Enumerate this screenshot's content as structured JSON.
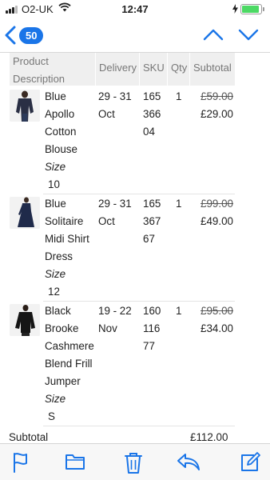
{
  "status_bar": {
    "carrier": "O2-UK",
    "time": "12:47",
    "battery_level": 0.92
  },
  "nav": {
    "unread_count": "50"
  },
  "table": {
    "headers": {
      "product_line1": "Product",
      "product_line2": "Description",
      "delivery": "Delivery",
      "sku": "SKU",
      "qty": "Qty",
      "subtotal": "Subtotal"
    },
    "rows": [
      {
        "desc": [
          "Blue",
          "Apollo",
          "Cotton",
          "Blouse"
        ],
        "size_label": "Size",
        "size_value": "10",
        "delivery": [
          "29 - 31",
          "Oct"
        ],
        "sku": [
          "165",
          "366",
          "04"
        ],
        "qty": "1",
        "was": "£59.00",
        "now": "£29.00",
        "thumb": "blouse-image"
      },
      {
        "desc": [
          "Blue",
          "Solitaire",
          "Midi Shirt",
          "Dress"
        ],
        "size_label": "Size",
        "size_value": "12",
        "delivery": [
          "29 - 31",
          "Oct"
        ],
        "sku": [
          "165",
          "367",
          "67"
        ],
        "qty": "1",
        "was": "£99.00",
        "now": "£49.00",
        "thumb": "dress-image"
      },
      {
        "desc": [
          "Black",
          "Brooke",
          "Cashmere",
          "Blend Frill",
          "Jumper"
        ],
        "size_label": "Size",
        "size_value": "S",
        "delivery": [
          "19 - 22",
          "Nov"
        ],
        "sku": [
          "160",
          "116",
          "77"
        ],
        "qty": "1",
        "was": "£95.00",
        "now": "£34.00",
        "thumb": "jumper-image"
      }
    ],
    "subtotal_label": "Subtotal",
    "subtotal_value": "£112.00"
  },
  "colors": {
    "accent": "#1a75e8",
    "header_bg": "#efefef"
  },
  "toolbar": {
    "icons": [
      "flag-icon",
      "folder-icon",
      "trash-icon",
      "reply-icon",
      "compose-icon"
    ]
  }
}
